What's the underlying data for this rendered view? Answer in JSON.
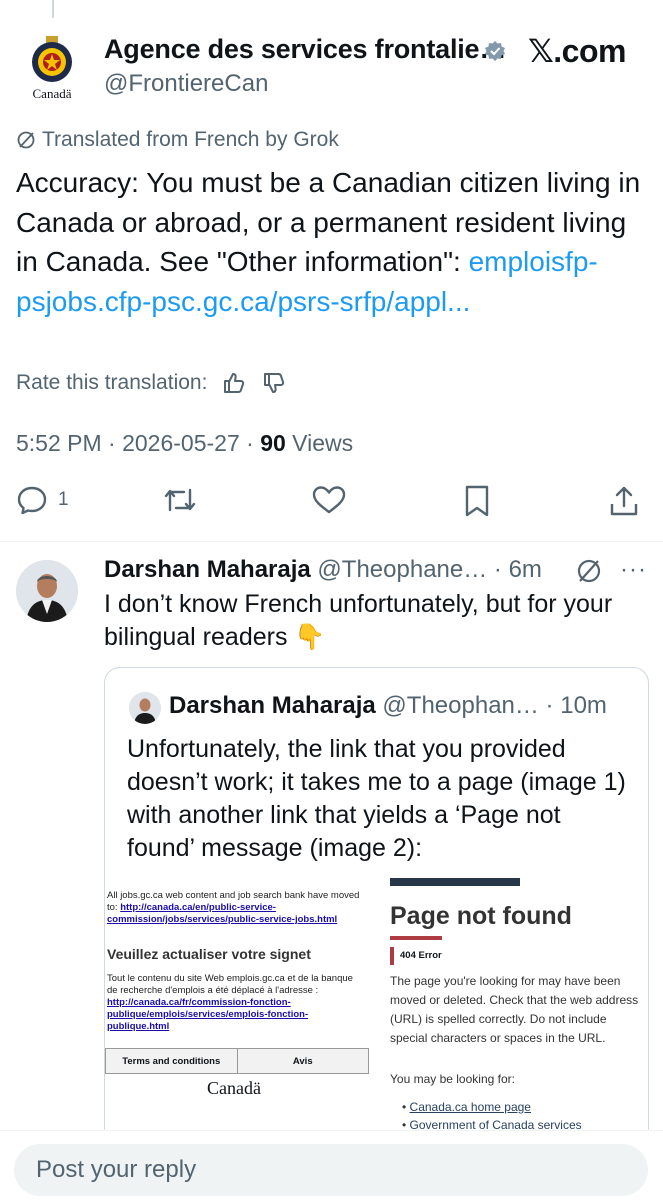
{
  "header": {
    "org_name": "Agence des services frontalie…",
    "handle": "@FrontiereCan",
    "site_badge": "𝕏.com",
    "logo_caption": "Canadä"
  },
  "tweet": {
    "translated_label": "Translated from French by Grok",
    "text": "Accuracy: You must be a Canadian citizen living in Canada or abroad, or a permanent resident living in Canada. See \"Other information\":",
    "link_text": "emploisfp-psjobs.cfp-psc.gc.ca/psrs-srfp/appl...",
    "rate_label": "Rate this translation:",
    "time": "5:52 PM · 2026-05-27 · ",
    "views_count": "90",
    "views_label": " Views",
    "actions": {
      "reply_count": "1"
    }
  },
  "reply": {
    "name": "Darshan Maharaja",
    "handle_time": " @Theophane… · 6m",
    "more": "···",
    "text": "I don’t know French unfortunately, but for your bilingual readers 👇"
  },
  "quote": {
    "name": "Darshan Maharaja",
    "handle_time": " @Theophan… · 10m",
    "text": "Unfortunately, the link that you provided doesn’t work; it takes me to a page (image 1) with another link that yields a ‘Page not found’ message (image 2):",
    "image1": {
      "text1": "All jobs.gc.ca web content and job search bank have moved to: ",
      "link1": "http://canada.ca/en/public-service-commission/jobs/services/public-service-jobs.html",
      "heading": "Veuillez actualiser votre signet",
      "text2": "Tout le contenu du site Web emplois.gc.ca et de la banque de recherche d'emplois a été déplacé à l'adresse : ",
      "link2": "http://canada.ca/fr/commission-fonction-publique/emplois/services/emplois-fonction-publique.html",
      "cell1": "Terms and conditions",
      "cell2": "Avis",
      "wordmark": "Canadä"
    },
    "image2": {
      "title": "Page not found",
      "badge": "404 Error",
      "body": "The page you're looking for may have been moved or deleted. Check that the web address (URL) is spelled correctly. Do not include special characters or spaces in the URL.",
      "sub": "You may be looking for:",
      "links": [
        "Canada.ca home page",
        "Government of Canada services"
      ]
    }
  },
  "reply_bar": {
    "placeholder": "Post your reply"
  },
  "colors": {
    "link": "#1d9bf0",
    "secondary_text": "#536471",
    "verified": "#829aab"
  }
}
